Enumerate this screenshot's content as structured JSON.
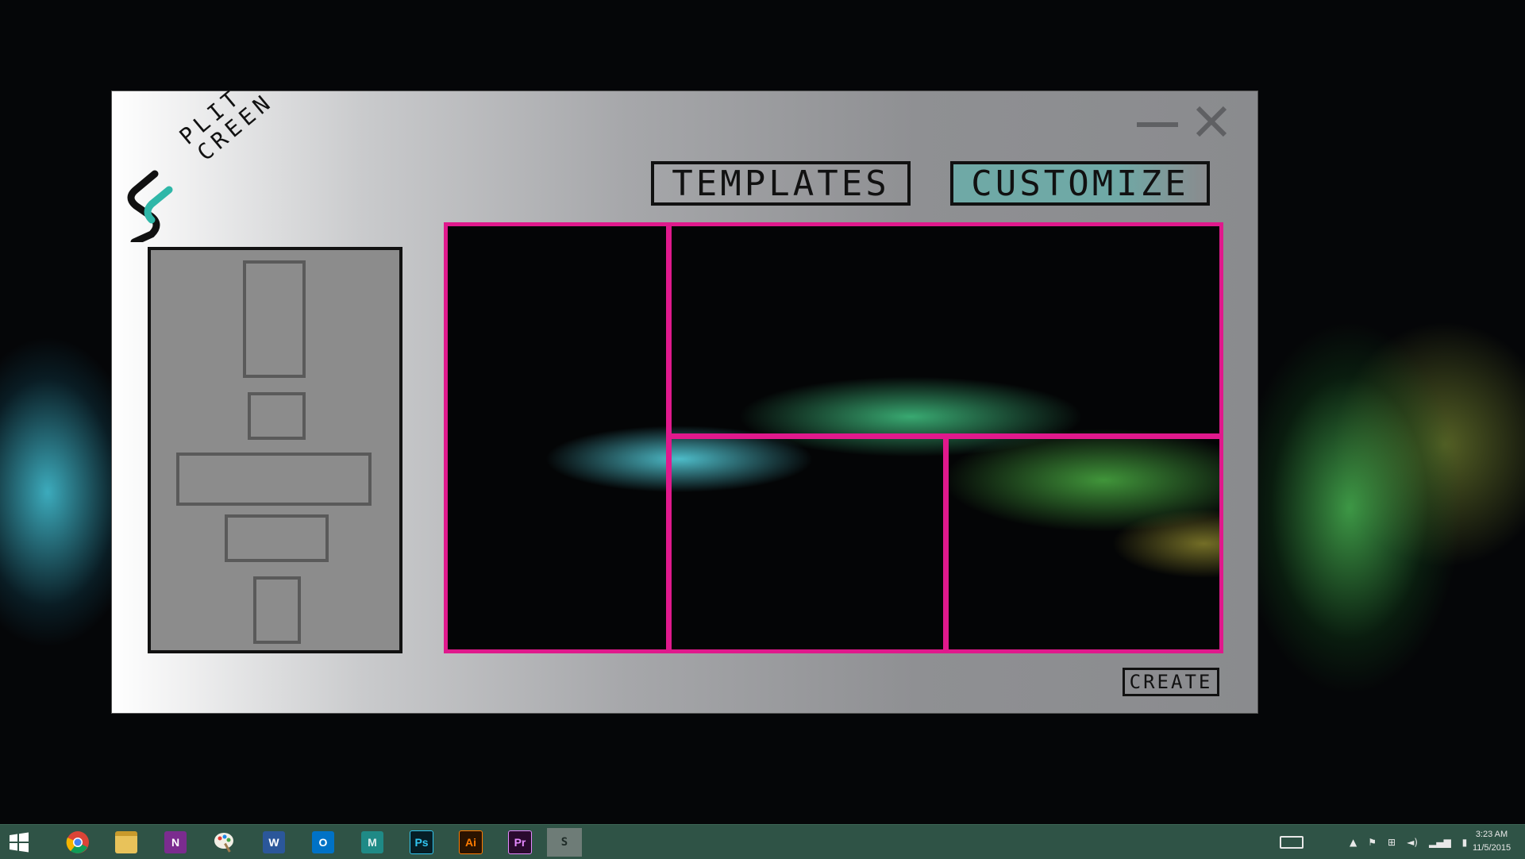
{
  "app": {
    "logo_lines": [
      "PLIT",
      "CREEN"
    ],
    "tabs": [
      {
        "label": "TEMPLATES",
        "active": false
      },
      {
        "label": "CUSTOMIZE",
        "active": true
      }
    ],
    "create_label": "CREATE",
    "colors": {
      "accent_border": "#e0198c",
      "active_tab": "#6fa9a6",
      "logo_teal": "#2fb7a8",
      "panel_gray": "#8c8c8c"
    },
    "shape_palette": [
      "tall-rect",
      "small-square",
      "wide-rect",
      "medium-rect",
      "small-tall-rect"
    ]
  },
  "taskbar": {
    "apps": [
      {
        "name": "start-icon",
        "label": ""
      },
      {
        "name": "chrome-icon",
        "label": ""
      },
      {
        "name": "file-explorer-icon",
        "label": ""
      },
      {
        "name": "onenote-icon",
        "label": "N"
      },
      {
        "name": "paint-icon",
        "label": ""
      },
      {
        "name": "word-icon",
        "label": "W"
      },
      {
        "name": "outlook-icon",
        "label": "O"
      },
      {
        "name": "maya-icon",
        "label": "M"
      },
      {
        "name": "photoshop-icon",
        "label": "Ps"
      },
      {
        "name": "illustrator-icon",
        "label": "Ai"
      },
      {
        "name": "premiere-icon",
        "label": "Pr"
      },
      {
        "name": "splitscreen-icon",
        "label": "S"
      }
    ],
    "clock_time": "3:23 AM",
    "clock_date": "11/5/2015"
  }
}
